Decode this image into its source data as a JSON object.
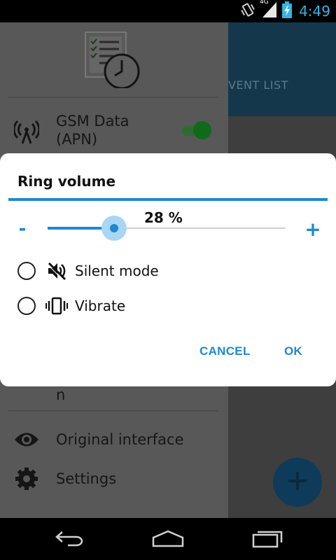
{
  "status_bar": {
    "network_type": "4G",
    "time": "4:49"
  },
  "app": {
    "tab_label": "VENT LIST",
    "fab_icon": "plus-icon"
  },
  "drawer": {
    "items": [
      {
        "label_line1": "GSM Data",
        "label_line2": "(APN)",
        "icon": "antenna-icon",
        "toggle_on": true
      },
      {
        "label": "Original interface",
        "icon": "eye-icon"
      },
      {
        "label": "Settings",
        "icon": "gear-icon"
      }
    ],
    "partial_text": "n"
  },
  "dialog": {
    "title": "Ring volume",
    "minus_label": "-",
    "plus_label": "+",
    "volume_percent": 28,
    "volume_text": "28 %",
    "options": [
      {
        "label": "Silent mode",
        "icon": "volume-off-icon",
        "selected": false
      },
      {
        "label": "Vibrate",
        "icon": "vibrate-icon",
        "selected": false
      }
    ],
    "cancel_label": "CANCEL",
    "ok_label": "OK"
  },
  "colors": {
    "accent": "#1e88d2",
    "clock": "#33b5e5",
    "toggle_on": "#0f6a1a"
  }
}
